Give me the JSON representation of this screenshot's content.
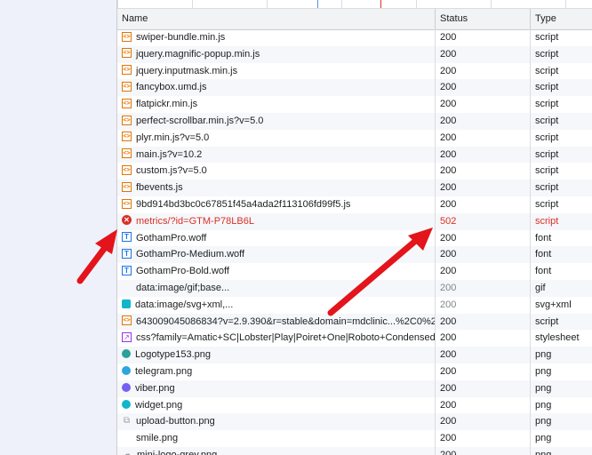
{
  "columns": {
    "name": "Name",
    "status": "Status",
    "type": "Type"
  },
  "colors": {
    "error": "#d93025",
    "arrow": "#e3141b",
    "script_icon": "#e37400",
    "font_icon": "#1a73e8"
  },
  "rows": [
    {
      "name": "swiper-bundle.min.js",
      "status": "200",
      "type": "script",
      "icon": "script-icon"
    },
    {
      "name": "jquery.magnific-popup.min.js",
      "status": "200",
      "type": "script",
      "icon": "script-icon"
    },
    {
      "name": "jquery.inputmask.min.js",
      "status": "200",
      "type": "script",
      "icon": "script-icon"
    },
    {
      "name": "fancybox.umd.js",
      "status": "200",
      "type": "script",
      "icon": "script-icon"
    },
    {
      "name": "flatpickr.min.js",
      "status": "200",
      "type": "script",
      "icon": "script-icon"
    },
    {
      "name": "perfect-scrollbar.min.js?v=5.0",
      "status": "200",
      "type": "script",
      "icon": "script-icon"
    },
    {
      "name": "plyr.min.js?v=5.0",
      "status": "200",
      "type": "script",
      "icon": "script-icon"
    },
    {
      "name": "main.js?v=10.2",
      "status": "200",
      "type": "script",
      "icon": "script-icon"
    },
    {
      "name": "custom.js?v=5.0",
      "status": "200",
      "type": "script",
      "icon": "script-icon"
    },
    {
      "name": "fbevents.js",
      "status": "200",
      "type": "script",
      "icon": "script-icon"
    },
    {
      "name": "9bd914bd3bc0c67851f45a4ada2f113106fd99f5.js",
      "status": "200",
      "type": "script",
      "icon": "script-icon"
    },
    {
      "name": "metrics/?id=GTM-P78LB6L",
      "status": "502",
      "type": "script",
      "icon": "error-icon",
      "error": true
    },
    {
      "name": "GothamPro.woff",
      "status": "200",
      "type": "font",
      "icon": "font-icon"
    },
    {
      "name": "GothamPro-Medium.woff",
      "status": "200",
      "type": "font",
      "icon": "font-icon"
    },
    {
      "name": "GothamPro-Bold.woff",
      "status": "200",
      "type": "font",
      "icon": "font-icon"
    },
    {
      "name": "data:image/gif;base...",
      "status": "200",
      "type": "gif",
      "icon": "blank-icon",
      "muted_status": true
    },
    {
      "name": "data:image/svg+xml,...",
      "status": "200",
      "type": "svg+xml",
      "icon": "svg-image-icon",
      "muted_status": true
    },
    {
      "name": "643009045086834?v=2.9.390&r=stable&domain=mdclinic...%2C0%2...",
      "status": "200",
      "type": "script",
      "icon": "script-icon"
    },
    {
      "name": "css?family=Amatic+SC|Lobster|Play|Poiret+One|Roboto+Condensed|...",
      "status": "200",
      "type": "stylesheet",
      "icon": "stylesheet-icon"
    },
    {
      "name": "Logotype153.png",
      "status": "200",
      "type": "png",
      "icon": "logo-image-icon",
      "color": "#2aa198"
    },
    {
      "name": "telegram.png",
      "status": "200",
      "type": "png",
      "icon": "telegram-image-icon",
      "color": "#2ca5e0"
    },
    {
      "name": "viber.png",
      "status": "200",
      "type": "png",
      "icon": "viber-image-icon",
      "color": "#7360f2"
    },
    {
      "name": "widget.png",
      "status": "200",
      "type": "png",
      "icon": "widget-image-icon",
      "color": "#12b5cb"
    },
    {
      "name": "upload-button.png",
      "status": "200",
      "type": "png",
      "icon": "paperclip-icon"
    },
    {
      "name": "smile.png",
      "status": "200",
      "type": "png",
      "icon": "blank-icon"
    },
    {
      "name": "mini-logo-grey.png",
      "status": "200",
      "type": "png",
      "icon": "cloud-image-icon"
    }
  ]
}
